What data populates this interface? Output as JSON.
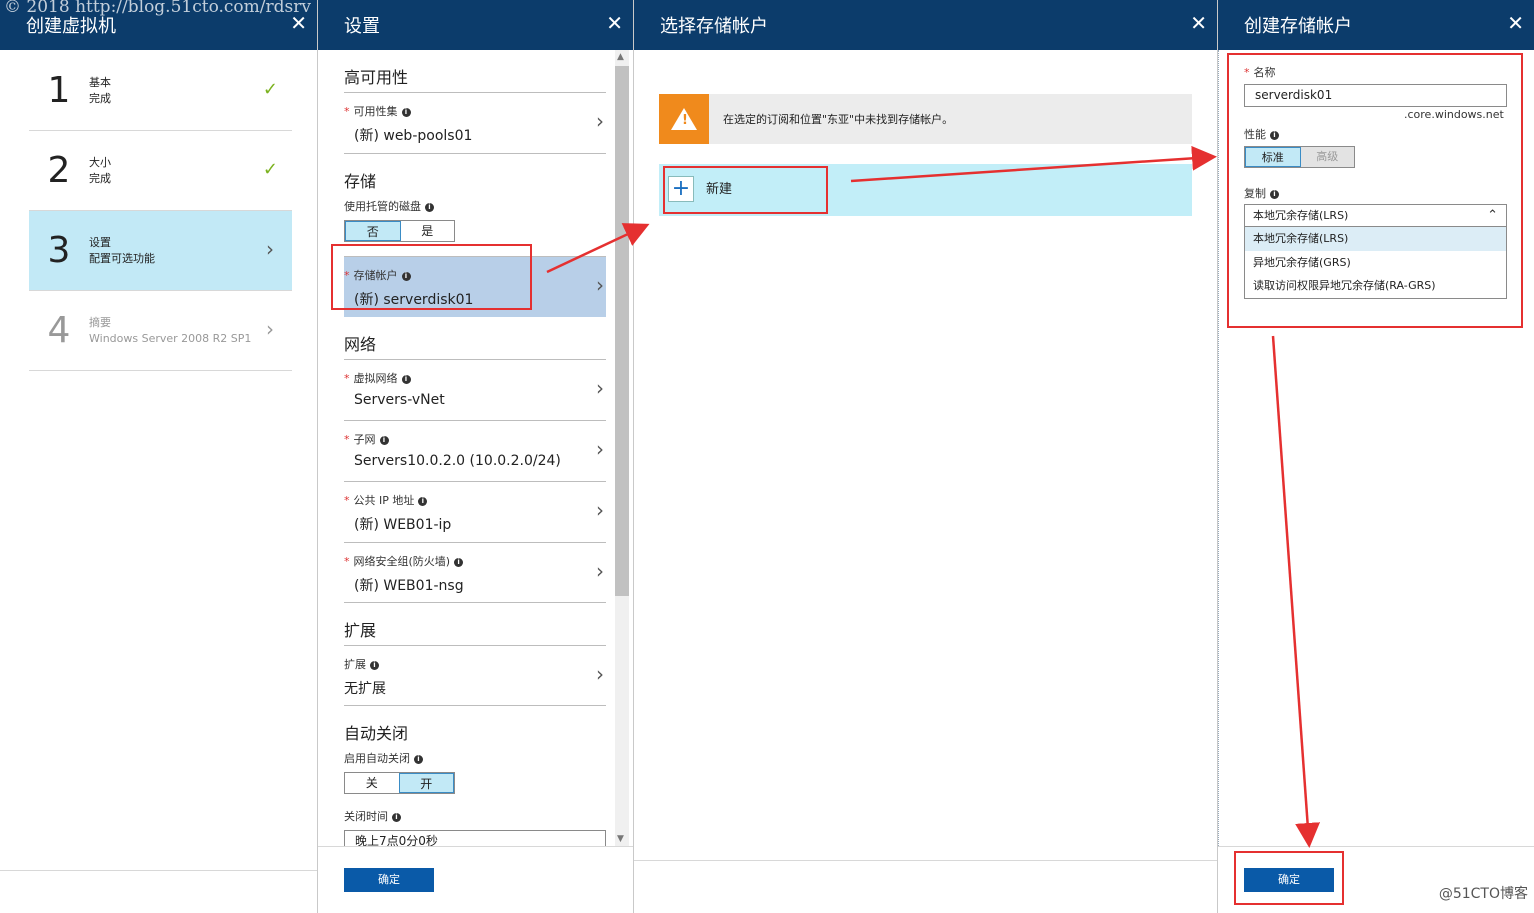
{
  "watermark": {
    "top": "© 2018 http://blog.51cto.com/rdsrv",
    "bottom": "@51CTO博客"
  },
  "blade1": {
    "title": "创建虚拟机",
    "close": "✕",
    "steps": [
      {
        "num": "1",
        "title": "基本",
        "sub": "完成",
        "status": "done"
      },
      {
        "num": "2",
        "title": "大小",
        "sub": "完成",
        "status": "done"
      },
      {
        "num": "3",
        "title": "设置",
        "sub": "配置可选功能",
        "status": "active"
      },
      {
        "num": "4",
        "title": "摘要",
        "sub": "Windows Server 2008 R2 SP1",
        "status": "pending"
      }
    ]
  },
  "blade2": {
    "title": "设置",
    "close": "✕",
    "ha": {
      "section": "高可用性",
      "avail_set": {
        "label": "可用性集",
        "value": "(新) web-pools01"
      }
    },
    "storage": {
      "section": "存储",
      "managed_label": "使用托管的磁盘",
      "managed_options": [
        "否",
        "是"
      ],
      "account": {
        "label": "存储帐户",
        "value": "(新) serverdisk01"
      }
    },
    "network": {
      "section": "网络",
      "vnet": {
        "label": "虚拟网络",
        "value": "Servers-vNet"
      },
      "subnet": {
        "label": "子网",
        "value": "Servers10.0.2.0 (10.0.2.0/24)"
      },
      "public_ip": {
        "label": "公共 IP 地址",
        "value": "(新) WEB01-ip"
      },
      "nsg": {
        "label": "网络安全组(防火墙)",
        "value": "(新) WEB01-nsg"
      }
    },
    "extensions": {
      "section": "扩展",
      "item": {
        "label": "扩展",
        "value": "无扩展"
      }
    },
    "autoshutdown": {
      "section": "自动关闭",
      "enable_label": "启用自动关闭",
      "options": [
        "关",
        "开"
      ],
      "time_label": "关闭时间",
      "time_value": "晚上7点0分0秒"
    },
    "ok": "确定"
  },
  "blade3": {
    "title": "选择存储帐户",
    "close": "✕",
    "warning": "在选定的订阅和位置\"东亚\"中未找到存储帐户。",
    "new_label": "新建"
  },
  "blade4": {
    "title": "创建存储帐户",
    "close": "✕",
    "name_label": "名称",
    "name_value": "serverdisk01",
    "name_suffix": ".core.windows.net",
    "perf_label": "性能",
    "perf_options": [
      "标准",
      "高级"
    ],
    "repl_label": "复制",
    "repl_selected": "本地冗余存储(LRS)",
    "repl_options": [
      "本地冗余存储(LRS)",
      "异地冗余存储(GRS)",
      "读取访问权限异地冗余存储(RA-GRS)"
    ],
    "ok": "确定"
  },
  "icons": {
    "check": "✓",
    "chevron": "›",
    "info": "i",
    "chevron_up": "⌃",
    "plus": "+",
    "warning": "!"
  }
}
